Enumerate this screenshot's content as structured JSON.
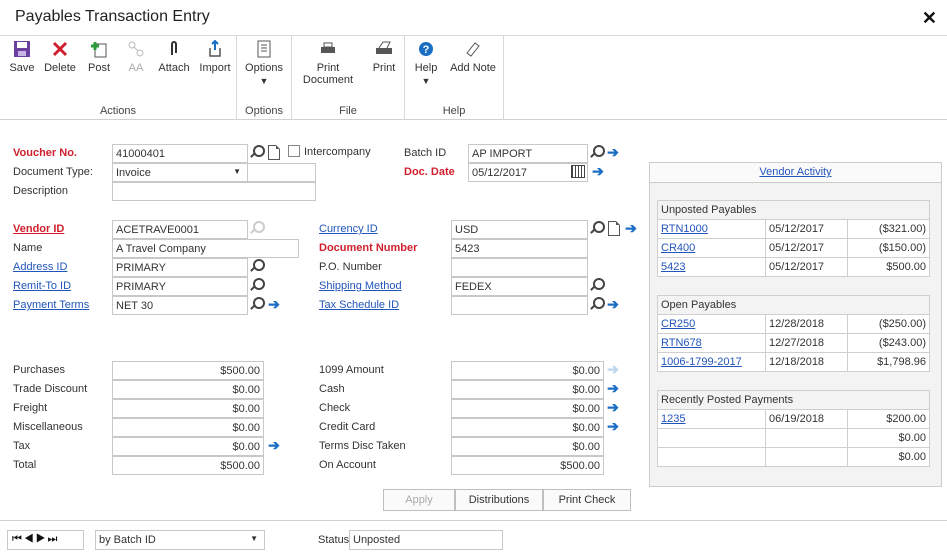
{
  "window": {
    "title": "Payables Transaction Entry",
    "close_glyph": "✕"
  },
  "ribbon": {
    "groups": [
      {
        "label": "Actions",
        "buttons": [
          "Save",
          "Delete",
          "Post",
          "AA",
          "Attach",
          "Import"
        ]
      },
      {
        "label": "Options",
        "buttons": [
          "Options"
        ]
      },
      {
        "label": "File",
        "buttons": [
          "Print Document",
          "Print"
        ]
      },
      {
        "label": "Help",
        "buttons": [
          "Help",
          "Add Note"
        ]
      }
    ],
    "labels": {
      "save": "Save",
      "delete": "Delete",
      "post": "Post",
      "aa": "AA",
      "attach": "Attach",
      "import": "Import",
      "options": "Options",
      "print_doc_1": "Print",
      "print_doc_2": "Document",
      "print": "Print",
      "help": "Help",
      "add_note": "Add Note",
      "g_actions": "Actions",
      "g_options": "Options",
      "g_file": "File",
      "g_help": "Help",
      "dropdown_glyph": "▼"
    }
  },
  "header": {
    "voucher_label": "Voucher No.",
    "voucher_value": "41000401",
    "intercompany_label": "Intercompany",
    "doctype_label": "Document Type:",
    "doctype_value": "Invoice",
    "description_label": "Description",
    "description_value": "",
    "batch_label": "Batch ID",
    "batch_value": "AP IMPORT",
    "docdate_label": "Doc. Date",
    "docdate_value": "05/12/2017"
  },
  "vendor": {
    "vendor_id_label": "Vendor ID",
    "vendor_id_value": "ACETRAVE0001",
    "name_label": "Name",
    "name_value": "A Travel Company",
    "address_label": "Address ID",
    "address_value": "PRIMARY",
    "remit_label": "Remit-To ID",
    "remit_value": "PRIMARY",
    "terms_label": "Payment Terms",
    "terms_value": "NET 30",
    "currency_label": "Currency ID",
    "currency_value": "USD",
    "docnum_label": "Document Number",
    "docnum_value": "5423",
    "po_label": "P.O. Number",
    "po_value": "",
    "shipping_label": "Shipping Method",
    "shipping_value": "FEDEX",
    "taxsched_label": "Tax Schedule ID",
    "taxsched_value": ""
  },
  "amounts_left": [
    {
      "label": "Purchases",
      "value": "$500.00"
    },
    {
      "label": "Trade Discount",
      "value": "$0.00"
    },
    {
      "label": "Freight",
      "value": "$0.00"
    },
    {
      "label": "Miscellaneous",
      "value": "$0.00"
    },
    {
      "label": "Tax",
      "value": "$0.00"
    },
    {
      "label": "Total",
      "value": "$500.00"
    }
  ],
  "amounts_right": [
    {
      "label": "1099 Amount",
      "value": "$0.00"
    },
    {
      "label": "Cash",
      "value": "$0.00"
    },
    {
      "label": "Check",
      "value": "$0.00"
    },
    {
      "label": "Credit Card",
      "value": "$0.00"
    },
    {
      "label": "Terms Disc Taken",
      "value": "$0.00"
    },
    {
      "label": "On Account",
      "value": "$500.00"
    }
  ],
  "vendor_activity": {
    "title": "Vendor Activity",
    "unposted": {
      "title": "Unposted Payables",
      "rows": [
        {
          "doc": "RTN1000",
          "date": "05/12/2017",
          "amount": "($321.00)"
        },
        {
          "doc": "CR400",
          "date": "05/12/2017",
          "amount": "($150.00)"
        },
        {
          "doc": "5423",
          "date": "05/12/2017",
          "amount": "$500.00"
        }
      ]
    },
    "open": {
      "title": "Open Payables",
      "rows": [
        {
          "doc": "CR250",
          "date": "12/28/2018",
          "amount": "($250.00)"
        },
        {
          "doc": "RTN678",
          "date": "12/27/2018",
          "amount": "($243.00)"
        },
        {
          "doc": "1006-1799-2017",
          "date": "12/18/2018",
          "amount": "$1,798.96"
        }
      ]
    },
    "payments": {
      "title": "Recently Posted Payments",
      "rows": [
        {
          "doc": "1235",
          "date": "06/19/2018",
          "amount": "$200.00"
        },
        {
          "doc": "",
          "date": "",
          "amount": "$0.00"
        },
        {
          "doc": "",
          "date": "",
          "amount": "$0.00"
        }
      ]
    }
  },
  "buttons": {
    "apply": "Apply",
    "distributions": "Distributions",
    "print_check": "Print Check"
  },
  "footer": {
    "nav_glyphs": "⏮◀▶⏭",
    "sort_value": "by Batch ID",
    "status_label": "Status",
    "status_value": "Unposted"
  },
  "colors": {
    "required": "#d0202d",
    "link": "#2255bb",
    "arrow": "#1a6fc4"
  }
}
